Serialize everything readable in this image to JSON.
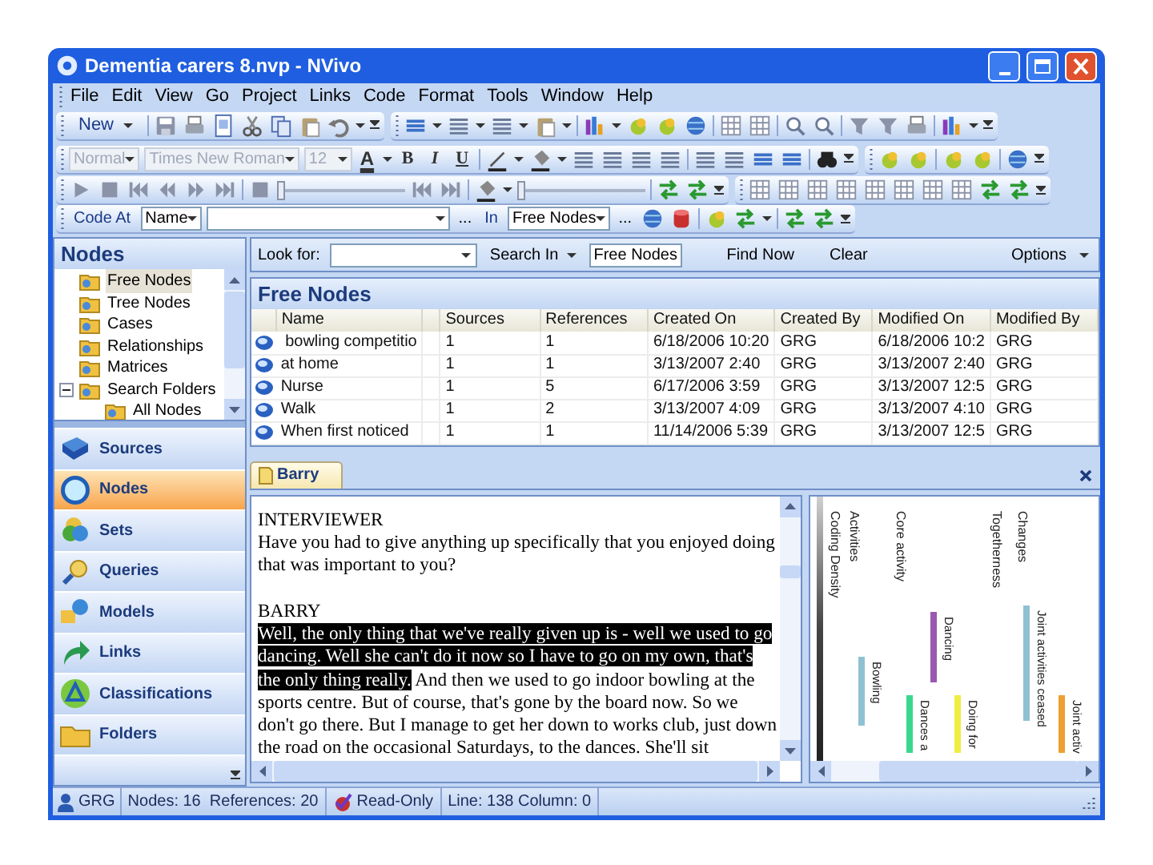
{
  "window": {
    "title": "Dementia carers 8.nvp - NVivo"
  },
  "menu": [
    "File",
    "Edit",
    "View",
    "Go",
    "Project",
    "Links",
    "Code",
    "Format",
    "Tools",
    "Window",
    "Help"
  ],
  "toolbar": {
    "new_button": "New",
    "style_combo": {
      "value": "Normal",
      "disabled": true
    },
    "font_combo": {
      "value": "Times New Roman",
      "disabled": true
    },
    "size_combo": {
      "value": "12",
      "disabled": true
    },
    "font_color_button": "A",
    "format_buttons": [
      "B",
      "I",
      "U"
    ],
    "media_sliders": [
      {
        "level": 0
      },
      {
        "level": 0
      }
    ]
  },
  "code_bar": {
    "label": "Code At",
    "field_combo": "Name",
    "more_button_1": "...",
    "in_label": "In",
    "in_combo": "Free Nodes",
    "more_button_2": "..."
  },
  "navigation": {
    "title": "Nodes",
    "tree": [
      {
        "label": "Free Nodes",
        "selected": true
      },
      {
        "label": "Tree Nodes",
        "selected": false
      },
      {
        "label": "Cases",
        "selected": false
      },
      {
        "label": "Relationships",
        "selected": false
      },
      {
        "label": "Matrices",
        "selected": false
      },
      {
        "label": "Search Folders",
        "selected": false,
        "expanded": true,
        "children": [
          {
            "label": "All Nodes",
            "selected": false
          }
        ]
      }
    ],
    "buttons": [
      {
        "label": "Sources",
        "selected": false
      },
      {
        "label": "Nodes",
        "selected": true
      },
      {
        "label": "Sets",
        "selected": false
      },
      {
        "label": "Queries",
        "selected": false
      },
      {
        "label": "Models",
        "selected": false
      },
      {
        "label": "Links",
        "selected": false
      },
      {
        "label": "Classifications",
        "selected": false
      },
      {
        "label": "Folders",
        "selected": false
      }
    ]
  },
  "find_bar": {
    "look_for_label": "Look for:",
    "search_in": "Search In",
    "search_in_value": "Free Nodes",
    "find_now": "Find Now",
    "clear": "Clear",
    "options": "Options"
  },
  "list": {
    "title": "Free Nodes",
    "columns": [
      "Name",
      "Sources",
      "References",
      "Created On",
      "Created By",
      "Modified On",
      "Modified By"
    ],
    "rows": [
      [
        " bowling competitio",
        "1",
        "1",
        "6/18/2006 10:20",
        "GRG",
        "6/18/2006 10:2",
        "GRG"
      ],
      [
        "at home",
        "1",
        "1",
        "3/13/2007 2:40",
        "GRG",
        "3/13/2007 2:40",
        "GRG"
      ],
      [
        "Nurse",
        "1",
        "5",
        "6/17/2006 3:59",
        "GRG",
        "3/13/2007 12:5",
        "GRG"
      ],
      [
        "Walk",
        "1",
        "2",
        "3/13/2007 4:09",
        "GRG",
        "3/13/2007 4:10",
        "GRG"
      ],
      [
        "When first noticed",
        "1",
        "1",
        "11/14/2006 5:39",
        "GRG",
        "3/13/2007 12:5",
        "GRG"
      ]
    ]
  },
  "detail": {
    "tab": "Barry",
    "blocks": [
      {
        "kind": "speaker",
        "segments": [
          {
            "text": "INTERVIEWER",
            "selected": false
          }
        ]
      },
      {
        "kind": "speech",
        "segments": [
          {
            "text": "Have you had to give anything up specifically that you enjoyed doing that was important to you?",
            "selected": false
          }
        ]
      },
      {
        "kind": "speaker",
        "segments": [
          {
            "text": "BARRY",
            "selected": false
          }
        ]
      },
      {
        "kind": "speech",
        "segments": [
          {
            "text": "Well, the only thing that we've really given up is - well we used to go dancing. Well she can't do it now so I have to go on my own, that's the only thing really.",
            "selected": true
          },
          {
            "text": " And then we used to go indoor bowling at the sports centre. But of course, that's gone by the board now. So we don't go there. But I manage to get her down to works club, just down the road on the occasional Saturdays, to the dances. She'll sit",
            "selected": false
          }
        ]
      }
    ]
  },
  "coding_stripes": {
    "headers": [
      "Changes",
      "Togetherness",
      "Core activity",
      "Activities",
      "Coding Density"
    ],
    "stripes": [
      {
        "label": "Joint activities ceased",
        "color": "#8fc1d2"
      },
      {
        "label": "Dancing",
        "color": "#9a58b0"
      },
      {
        "label": "Bowling",
        "color": "#8fc1d2"
      },
      {
        "label": "Dances a",
        "color": "#3ad88e"
      },
      {
        "label": "Doing for",
        "color": "#f0ee40"
      },
      {
        "label": "Joint activ",
        "color": "#eea030"
      }
    ]
  },
  "status_bar": {
    "user": "GRG",
    "counts": "Nodes: 16  References: 20",
    "mode": "Read-Only",
    "position": "Line: 138 Column: 0"
  }
}
